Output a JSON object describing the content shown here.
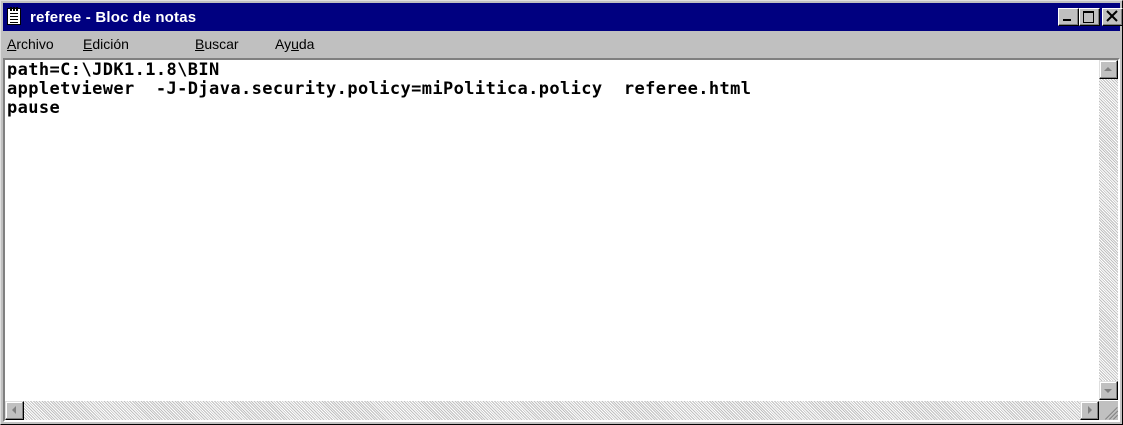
{
  "window": {
    "title": "referee - Bloc de notas",
    "title_bar_color": "#000080",
    "controls": [
      "minimize-icon",
      "maximize-icon",
      "close-icon"
    ]
  },
  "menu": {
    "items": [
      {
        "underline": "A",
        "rest": "rchivo"
      },
      {
        "underline": "E",
        "rest": "dición"
      },
      {
        "underline": "B",
        "rest": "uscar"
      },
      {
        "pre": "Ay",
        "underline": "u",
        "rest": "da"
      }
    ]
  },
  "editor": {
    "lines": [
      "path=C:\\JDK1.1.8\\BIN",
      "appletviewer  -J-Djava.security.policy=miPolitica.policy  referee.html",
      "pause"
    ]
  },
  "scrollbars": {
    "icons": [
      "scroll-up-arrow-icon",
      "scroll-down-arrow-icon",
      "scroll-left-arrow-icon",
      "scroll-right-arrow-icon"
    ]
  }
}
